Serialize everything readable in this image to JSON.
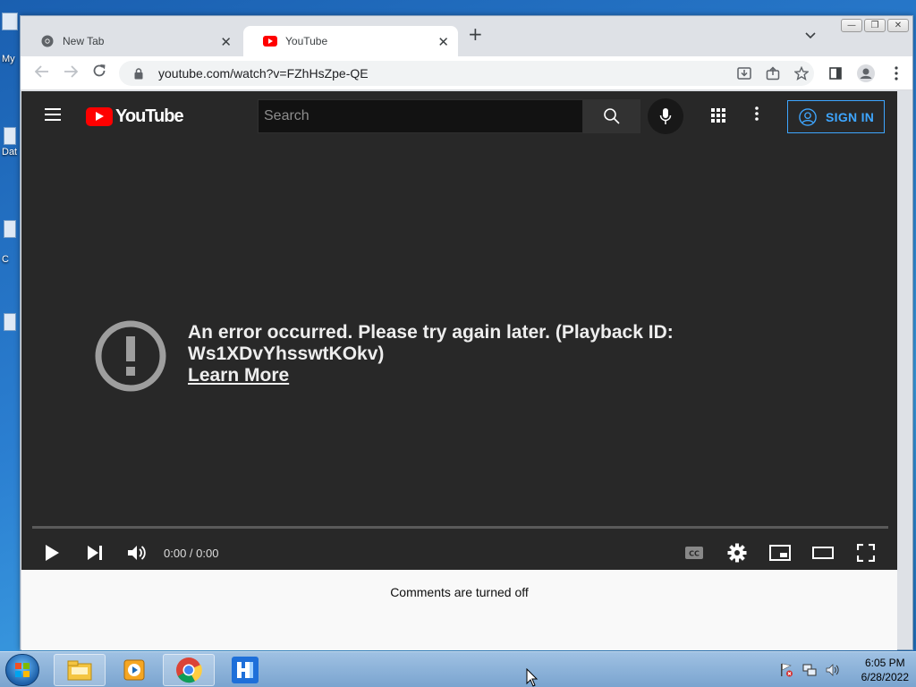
{
  "desktop": {
    "labels": [
      "My",
      "Dat",
      "C"
    ]
  },
  "window": {
    "controls": {
      "minimize": "—",
      "restore": "❐",
      "close": "✕"
    }
  },
  "tabs": [
    {
      "title": "New Tab",
      "icon": "chrome-icon",
      "active": false
    },
    {
      "title": "YouTube",
      "icon": "youtube-icon",
      "active": true
    }
  ],
  "toolbar": {
    "url": "youtube.com/watch?v=FZhHsZpe-QE",
    "new_tab_symbol": "+",
    "close_symbol": "✕"
  },
  "youtube": {
    "logo_text": "YouTube",
    "search_placeholder": "Search",
    "signin_label": "SIGN IN",
    "error_message": "An error occurred. Please try again later. (Playback ID: Ws1XDvYhsswtKOkv)",
    "learn_more": "Learn More",
    "time_display": "0:00 / 0:00",
    "comments_status": "Comments are turned off"
  },
  "taskbar": {
    "apps": [
      "explorer-icon",
      "media-player-icon",
      "chrome-icon",
      "app-icon"
    ],
    "clock_time": "6:05 PM",
    "clock_date": "6/28/2022"
  },
  "colors": {
    "yt_red": "#ff0000",
    "signin_blue": "#3ea6ff",
    "player_bg": "#282828"
  }
}
